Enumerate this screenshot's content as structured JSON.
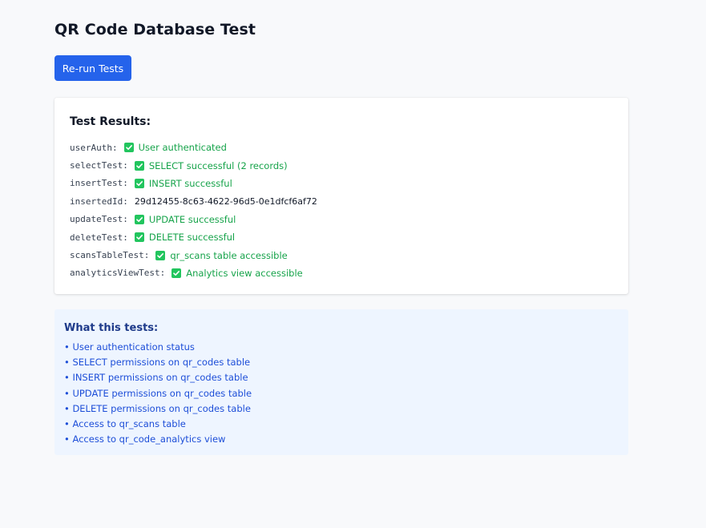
{
  "page": {
    "title": "QR Code Database Test"
  },
  "toolbar": {
    "rerun_label": "Re-run Tests"
  },
  "results": {
    "heading": "Test Results:",
    "rows": [
      {
        "key": "userAuth:",
        "value": "User authenticated",
        "status": "success"
      },
      {
        "key": "selectTest:",
        "value": "SELECT successful (2 records)",
        "status": "success"
      },
      {
        "key": "insertTest:",
        "value": "INSERT successful",
        "status": "success"
      },
      {
        "key": "insertedId:",
        "value": "29d12455-8c63-4622-96d5-0e1dfcf6af72",
        "status": "plain"
      },
      {
        "key": "updateTest:",
        "value": "UPDATE successful",
        "status": "success"
      },
      {
        "key": "deleteTest:",
        "value": "DELETE successful",
        "status": "success"
      },
      {
        "key": "scansTableTest:",
        "value": "qr_scans table accessible",
        "status": "success"
      },
      {
        "key": "analyticsViewTest:",
        "value": "Analytics view accessible",
        "status": "success"
      }
    ]
  },
  "info": {
    "heading": "What this tests:",
    "items": [
      "• User authentication status",
      "• SELECT permissions on qr_codes table",
      "• INSERT permissions on qr_codes table",
      "• UPDATE permissions on qr_codes table",
      "• DELETE permissions on qr_codes table",
      "• Access to qr_scans table",
      "• Access to qr_code_analytics view"
    ]
  },
  "colors": {
    "accent": "#2563eb",
    "success": "#16a34a",
    "check_bg": "#22c55e",
    "info_bg": "#eef5ff",
    "info_text": "#1d4ed8"
  },
  "icons": {
    "success": "check-box-icon"
  }
}
